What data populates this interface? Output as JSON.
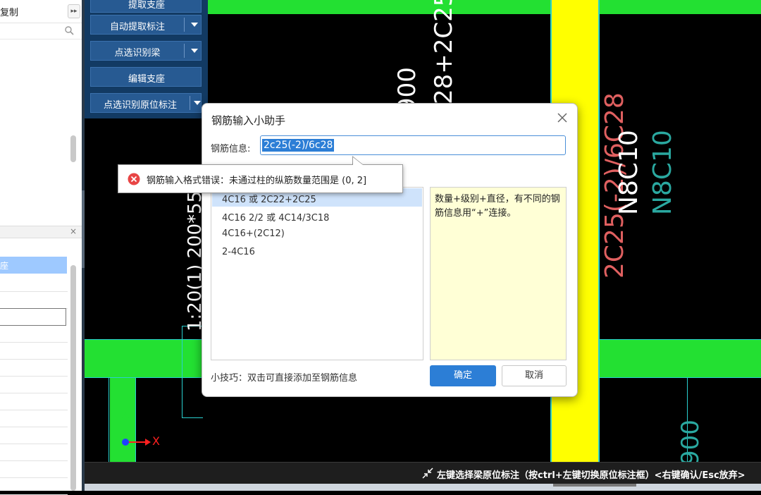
{
  "left_panel": {
    "top_label": "复制",
    "collapse_glyph": "▸▸",
    "close_glyph": "×",
    "selected_row_text": "座"
  },
  "toolbar": {
    "items": [
      {
        "label": "提取支座",
        "dropdown": false
      },
      {
        "label": "自动提取标注",
        "dropdown": true
      },
      {
        "label": "点选识别梁",
        "dropdown": true
      },
      {
        "label": "编辑支座",
        "dropdown": false
      },
      {
        "label": "点选识别原位标注",
        "dropdown": true
      }
    ]
  },
  "cad": {
    "texts": {
      "top_vertical": "28+2C25",
      "mid_vertical_900": "900",
      "left_vertical": "1:20(1) 200*550",
      "red_vertical": "2C25(-2)/6C28",
      "white_vertical": "N8C10",
      "cyan_vertical": "N8C10",
      "bottom_right_vertical": "900"
    },
    "axis_label_x": "X",
    "colors": {
      "column_green": "#23e032",
      "beam_yellow": "#ffff00",
      "annotation_red": "#e06060",
      "annotation_cyan": "#2aa8a0",
      "axis_red": "#ff2020"
    }
  },
  "dialog": {
    "title": "钢筋输入小助手",
    "close_glyph": "×",
    "field_label": "钢筋信息:",
    "field_value": "2c25(-2)/6c28",
    "examples": [
      "4C16 或 2C22+2C25",
      "4C16 2/2 或 4C14/3C18",
      "4C16+(2C12)",
      "2-4C16"
    ],
    "hint": "数量+级别+直径，有不同的钢筋信息用“+”连接。",
    "tip": "小技巧：双击可直接添加至钢筋信息",
    "ok_label": "确定",
    "cancel_label": "取消"
  },
  "error_tooltip": {
    "message": "钢筋输入格式错误：未通过柱的纵筋数量范围是 (0, 2]"
  },
  "status_bar": {
    "text": "左键选择梁原位标注（按ctrl+左键切换原位标注框）<右键确认/Esc放弃>"
  }
}
